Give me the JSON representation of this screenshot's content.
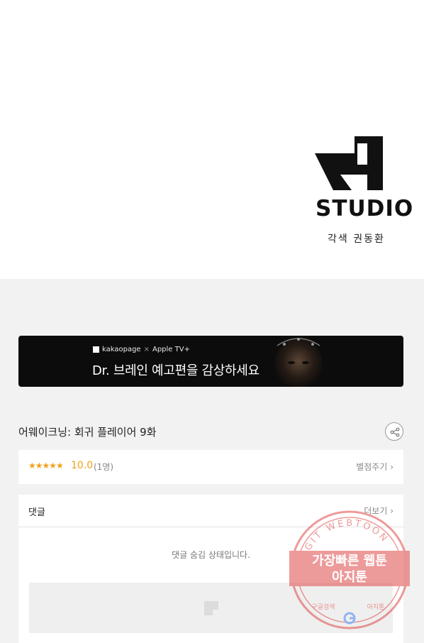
{
  "studio": {
    "logo_text": "STUDIO",
    "credit": "각색 권동환"
  },
  "banner": {
    "brand_kakao": "kakaopage",
    "brand_sep": "×",
    "brand_apple": "Apple TV+",
    "headline": "Dr. 브레인 예고편을 감상하세요"
  },
  "episode": {
    "title": "어웨이크닝: 회귀 플레이어 9화"
  },
  "rating": {
    "stars": "★★★★★",
    "score": "10.0",
    "count": "(1명)",
    "rate_label": "별점주기"
  },
  "comments": {
    "title": "댓글",
    "more_label": "더보기",
    "hidden_message": "댓글 숨김 상태입니다."
  },
  "watermark": {
    "ring_text": "AGIT WEBTOON",
    "line1": "가장빠른 웹툰",
    "line2": "아지툰",
    "bottom_left": "구글검색",
    "bottom_right": "아지툰"
  },
  "colors": {
    "star": "#f0a219",
    "banner_bg": "#0c0c0c",
    "page_bg": "#f2f2f2",
    "watermark": "#e04848"
  }
}
